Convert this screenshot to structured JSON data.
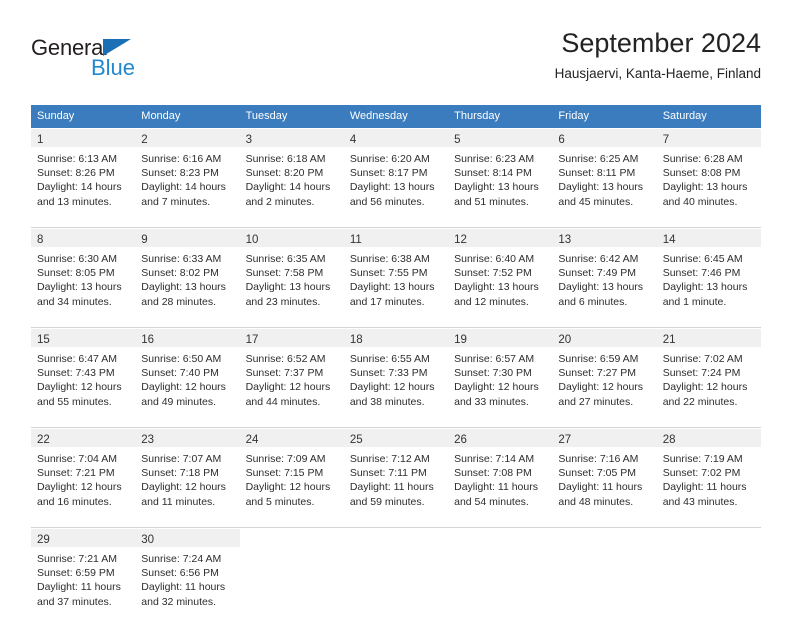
{
  "brand": {
    "name_primary": "General",
    "name_secondary": "Blue",
    "accent_color": "#2389cf",
    "triangle_color": "#1c6fb5"
  },
  "header": {
    "title": "September 2024",
    "subtitle": "Hausjaervi, Kanta-Haeme, Finland"
  },
  "theme": {
    "header_row_color": "#3a7cbe",
    "daynum_band_color": "#f0f0f0",
    "separator_color": "#d4d4d4"
  },
  "weekdays": [
    "Sunday",
    "Monday",
    "Tuesday",
    "Wednesday",
    "Thursday",
    "Friday",
    "Saturday"
  ],
  "weeks": [
    [
      {
        "day": "1",
        "sunrise": "Sunrise: 6:13 AM",
        "sunset": "Sunset: 8:26 PM",
        "daylight_line1": "Daylight: 14 hours",
        "daylight_line2": "and 13 minutes."
      },
      {
        "day": "2",
        "sunrise": "Sunrise: 6:16 AM",
        "sunset": "Sunset: 8:23 PM",
        "daylight_line1": "Daylight: 14 hours",
        "daylight_line2": "and 7 minutes."
      },
      {
        "day": "3",
        "sunrise": "Sunrise: 6:18 AM",
        "sunset": "Sunset: 8:20 PM",
        "daylight_line1": "Daylight: 14 hours",
        "daylight_line2": "and 2 minutes."
      },
      {
        "day": "4",
        "sunrise": "Sunrise: 6:20 AM",
        "sunset": "Sunset: 8:17 PM",
        "daylight_line1": "Daylight: 13 hours",
        "daylight_line2": "and 56 minutes."
      },
      {
        "day": "5",
        "sunrise": "Sunrise: 6:23 AM",
        "sunset": "Sunset: 8:14 PM",
        "daylight_line1": "Daylight: 13 hours",
        "daylight_line2": "and 51 minutes."
      },
      {
        "day": "6",
        "sunrise": "Sunrise: 6:25 AM",
        "sunset": "Sunset: 8:11 PM",
        "daylight_line1": "Daylight: 13 hours",
        "daylight_line2": "and 45 minutes."
      },
      {
        "day": "7",
        "sunrise": "Sunrise: 6:28 AM",
        "sunset": "Sunset: 8:08 PM",
        "daylight_line1": "Daylight: 13 hours",
        "daylight_line2": "and 40 minutes."
      }
    ],
    [
      {
        "day": "8",
        "sunrise": "Sunrise: 6:30 AM",
        "sunset": "Sunset: 8:05 PM",
        "daylight_line1": "Daylight: 13 hours",
        "daylight_line2": "and 34 minutes."
      },
      {
        "day": "9",
        "sunrise": "Sunrise: 6:33 AM",
        "sunset": "Sunset: 8:02 PM",
        "daylight_line1": "Daylight: 13 hours",
        "daylight_line2": "and 28 minutes."
      },
      {
        "day": "10",
        "sunrise": "Sunrise: 6:35 AM",
        "sunset": "Sunset: 7:58 PM",
        "daylight_line1": "Daylight: 13 hours",
        "daylight_line2": "and 23 minutes."
      },
      {
        "day": "11",
        "sunrise": "Sunrise: 6:38 AM",
        "sunset": "Sunset: 7:55 PM",
        "daylight_line1": "Daylight: 13 hours",
        "daylight_line2": "and 17 minutes."
      },
      {
        "day": "12",
        "sunrise": "Sunrise: 6:40 AM",
        "sunset": "Sunset: 7:52 PM",
        "daylight_line1": "Daylight: 13 hours",
        "daylight_line2": "and 12 minutes."
      },
      {
        "day": "13",
        "sunrise": "Sunrise: 6:42 AM",
        "sunset": "Sunset: 7:49 PM",
        "daylight_line1": "Daylight: 13 hours",
        "daylight_line2": "and 6 minutes."
      },
      {
        "day": "14",
        "sunrise": "Sunrise: 6:45 AM",
        "sunset": "Sunset: 7:46 PM",
        "daylight_line1": "Daylight: 13 hours",
        "daylight_line2": "and 1 minute."
      }
    ],
    [
      {
        "day": "15",
        "sunrise": "Sunrise: 6:47 AM",
        "sunset": "Sunset: 7:43 PM",
        "daylight_line1": "Daylight: 12 hours",
        "daylight_line2": "and 55 minutes."
      },
      {
        "day": "16",
        "sunrise": "Sunrise: 6:50 AM",
        "sunset": "Sunset: 7:40 PM",
        "daylight_line1": "Daylight: 12 hours",
        "daylight_line2": "and 49 minutes."
      },
      {
        "day": "17",
        "sunrise": "Sunrise: 6:52 AM",
        "sunset": "Sunset: 7:37 PM",
        "daylight_line1": "Daylight: 12 hours",
        "daylight_line2": "and 44 minutes."
      },
      {
        "day": "18",
        "sunrise": "Sunrise: 6:55 AM",
        "sunset": "Sunset: 7:33 PM",
        "daylight_line1": "Daylight: 12 hours",
        "daylight_line2": "and 38 minutes."
      },
      {
        "day": "19",
        "sunrise": "Sunrise: 6:57 AM",
        "sunset": "Sunset: 7:30 PM",
        "daylight_line1": "Daylight: 12 hours",
        "daylight_line2": "and 33 minutes."
      },
      {
        "day": "20",
        "sunrise": "Sunrise: 6:59 AM",
        "sunset": "Sunset: 7:27 PM",
        "daylight_line1": "Daylight: 12 hours",
        "daylight_line2": "and 27 minutes."
      },
      {
        "day": "21",
        "sunrise": "Sunrise: 7:02 AM",
        "sunset": "Sunset: 7:24 PM",
        "daylight_line1": "Daylight: 12 hours",
        "daylight_line2": "and 22 minutes."
      }
    ],
    [
      {
        "day": "22",
        "sunrise": "Sunrise: 7:04 AM",
        "sunset": "Sunset: 7:21 PM",
        "daylight_line1": "Daylight: 12 hours",
        "daylight_line2": "and 16 minutes."
      },
      {
        "day": "23",
        "sunrise": "Sunrise: 7:07 AM",
        "sunset": "Sunset: 7:18 PM",
        "daylight_line1": "Daylight: 12 hours",
        "daylight_line2": "and 11 minutes."
      },
      {
        "day": "24",
        "sunrise": "Sunrise: 7:09 AM",
        "sunset": "Sunset: 7:15 PM",
        "daylight_line1": "Daylight: 12 hours",
        "daylight_line2": "and 5 minutes."
      },
      {
        "day": "25",
        "sunrise": "Sunrise: 7:12 AM",
        "sunset": "Sunset: 7:11 PM",
        "daylight_line1": "Daylight: 11 hours",
        "daylight_line2": "and 59 minutes."
      },
      {
        "day": "26",
        "sunrise": "Sunrise: 7:14 AM",
        "sunset": "Sunset: 7:08 PM",
        "daylight_line1": "Daylight: 11 hours",
        "daylight_line2": "and 54 minutes."
      },
      {
        "day": "27",
        "sunrise": "Sunrise: 7:16 AM",
        "sunset": "Sunset: 7:05 PM",
        "daylight_line1": "Daylight: 11 hours",
        "daylight_line2": "and 48 minutes."
      },
      {
        "day": "28",
        "sunrise": "Sunrise: 7:19 AM",
        "sunset": "Sunset: 7:02 PM",
        "daylight_line1": "Daylight: 11 hours",
        "daylight_line2": "and 43 minutes."
      }
    ],
    [
      {
        "day": "29",
        "sunrise": "Sunrise: 7:21 AM",
        "sunset": "Sunset: 6:59 PM",
        "daylight_line1": "Daylight: 11 hours",
        "daylight_line2": "and 37 minutes."
      },
      {
        "day": "30",
        "sunrise": "Sunrise: 7:24 AM",
        "sunset": "Sunset: 6:56 PM",
        "daylight_line1": "Daylight: 11 hours",
        "daylight_line2": "and 32 minutes."
      },
      {
        "day": "",
        "sunrise": "",
        "sunset": "",
        "daylight_line1": "",
        "daylight_line2": ""
      },
      {
        "day": "",
        "sunrise": "",
        "sunset": "",
        "daylight_line1": "",
        "daylight_line2": ""
      },
      {
        "day": "",
        "sunrise": "",
        "sunset": "",
        "daylight_line1": "",
        "daylight_line2": ""
      },
      {
        "day": "",
        "sunrise": "",
        "sunset": "",
        "daylight_line1": "",
        "daylight_line2": ""
      },
      {
        "day": "",
        "sunrise": "",
        "sunset": "",
        "daylight_line1": "",
        "daylight_line2": ""
      }
    ]
  ]
}
